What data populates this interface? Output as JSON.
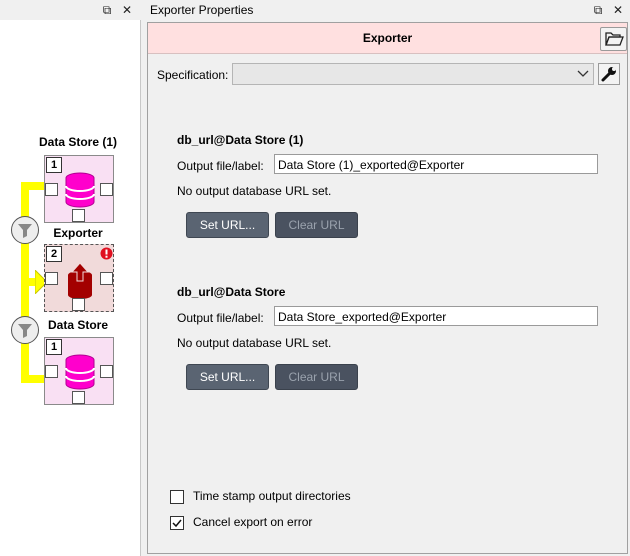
{
  "left_panel": {
    "items": [
      {
        "name": "Data Store (1)",
        "badge": "1",
        "icon": "database-icon"
      },
      {
        "name": "Exporter",
        "badge": "2",
        "icon": "exporter-icon",
        "status_icon": "error-icon"
      },
      {
        "name": "Data Store",
        "badge": "1",
        "icon": "database-icon"
      }
    ],
    "buttons": {
      "float": "⧉",
      "close": "✕"
    }
  },
  "right_panel": {
    "title": "Exporter Properties",
    "buttons": {
      "float": "⧉",
      "close": "✕"
    },
    "item_name": "Exporter",
    "specification_label": "Specification:",
    "specification_value": "",
    "sections": [
      {
        "title": "db_url@Data Store (1)",
        "output_label": "Output file/label:",
        "output_value": "Data Store (1)_exported@Exporter",
        "status": "No output database URL set.",
        "set_url": "Set URL...",
        "clear_url": "Clear URL"
      },
      {
        "title": "db_url@Data Store",
        "output_label": "Output file/label:",
        "output_value": "Data Store_exported@Exporter",
        "status": "No output database URL set.",
        "set_url": "Set URL...",
        "clear_url": "Clear URL"
      }
    ],
    "options": [
      {
        "label": "Time stamp output directories",
        "checked": false
      },
      {
        "label": "Cancel export on error",
        "checked": true
      }
    ]
  },
  "colors": {
    "link": "#ffff00",
    "header_bg": "#ffe0e0",
    "db_magenta": "#ff00cc",
    "exporter_red": "#a30000"
  }
}
